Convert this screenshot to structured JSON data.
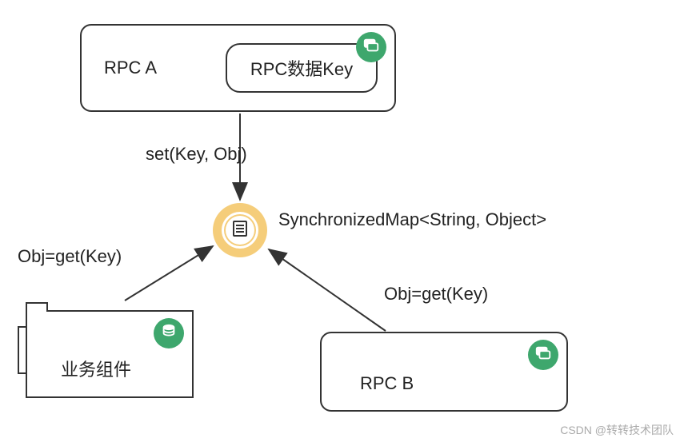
{
  "nodes": {
    "rpc_a": {
      "label": "RPC A"
    },
    "rpc_data_key": {
      "label": "RPC数据Key"
    },
    "rpc_b": {
      "label": "RPC B"
    },
    "biz_component": {
      "label": "业务组件"
    },
    "sync_map": {
      "label": "SynchronizedMap<String, Object>"
    }
  },
  "edges": {
    "rpc_a_to_map": {
      "label": "set(Key, Obj)"
    },
    "biz_to_map": {
      "label": "Obj=get(Key)"
    },
    "rpc_b_to_map": {
      "label": "Obj=get(Key)"
    }
  },
  "icons": {
    "rpc_a_badge": "chat-icon",
    "rpc_b_badge": "chat-icon",
    "biz_badge": "database-icon",
    "center": "list-icon"
  },
  "watermark": "CSDN @转转技术团队"
}
